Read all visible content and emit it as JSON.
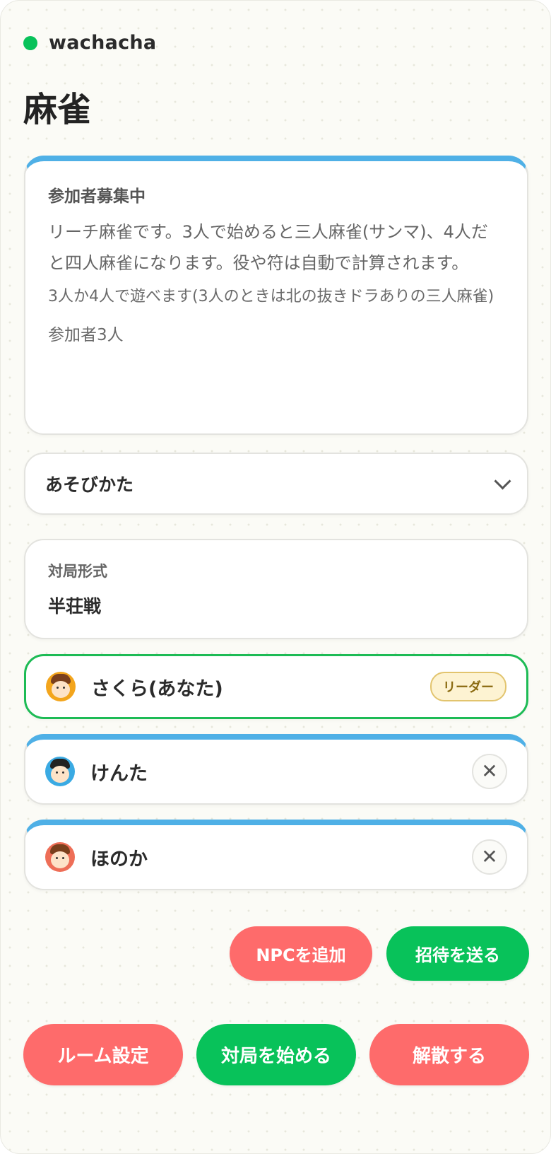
{
  "app": {
    "brand": "wachacha",
    "status_color": "#08c25a"
  },
  "page": {
    "title": "麻雀"
  },
  "info": {
    "status": "参加者募集中",
    "description": "リーチ麻雀です。3人で始めると三人麻雀(サンマ)、4人だと四人麻雀になります。役や符は自動で計算されます。",
    "players_note": "3人か4人で遊べます(3人のときは北の抜きドラありの三人麻雀)",
    "count": "参加者3人"
  },
  "howto": {
    "label": "あそびかた",
    "icon": "chevron-down-icon"
  },
  "format": {
    "label": "対局形式",
    "value": "半荘戦"
  },
  "players": [
    {
      "name": "さくら(あなた)",
      "badge": "リーダー",
      "avatar": "girl-avatar-icon",
      "avatar_color": "#f3a51c"
    },
    {
      "name": "けんた",
      "remove": "✕",
      "avatar": "boy-avatar-icon",
      "avatar_color": "#3aaae3"
    },
    {
      "name": "ほのか",
      "remove": "✕",
      "avatar": "girl-avatar-icon",
      "avatar_color": "#ee6e57"
    }
  ],
  "actions": {
    "add_npc": "NPCを追加",
    "invite": "招待を送る"
  },
  "footer": {
    "settings": "ルーム設定",
    "start": "対局を始める",
    "disband": "解散する"
  },
  "colors": {
    "accent_green": "#08c25a",
    "accent_red": "#fe6b6b",
    "accent_blue": "#4fb0e6"
  }
}
